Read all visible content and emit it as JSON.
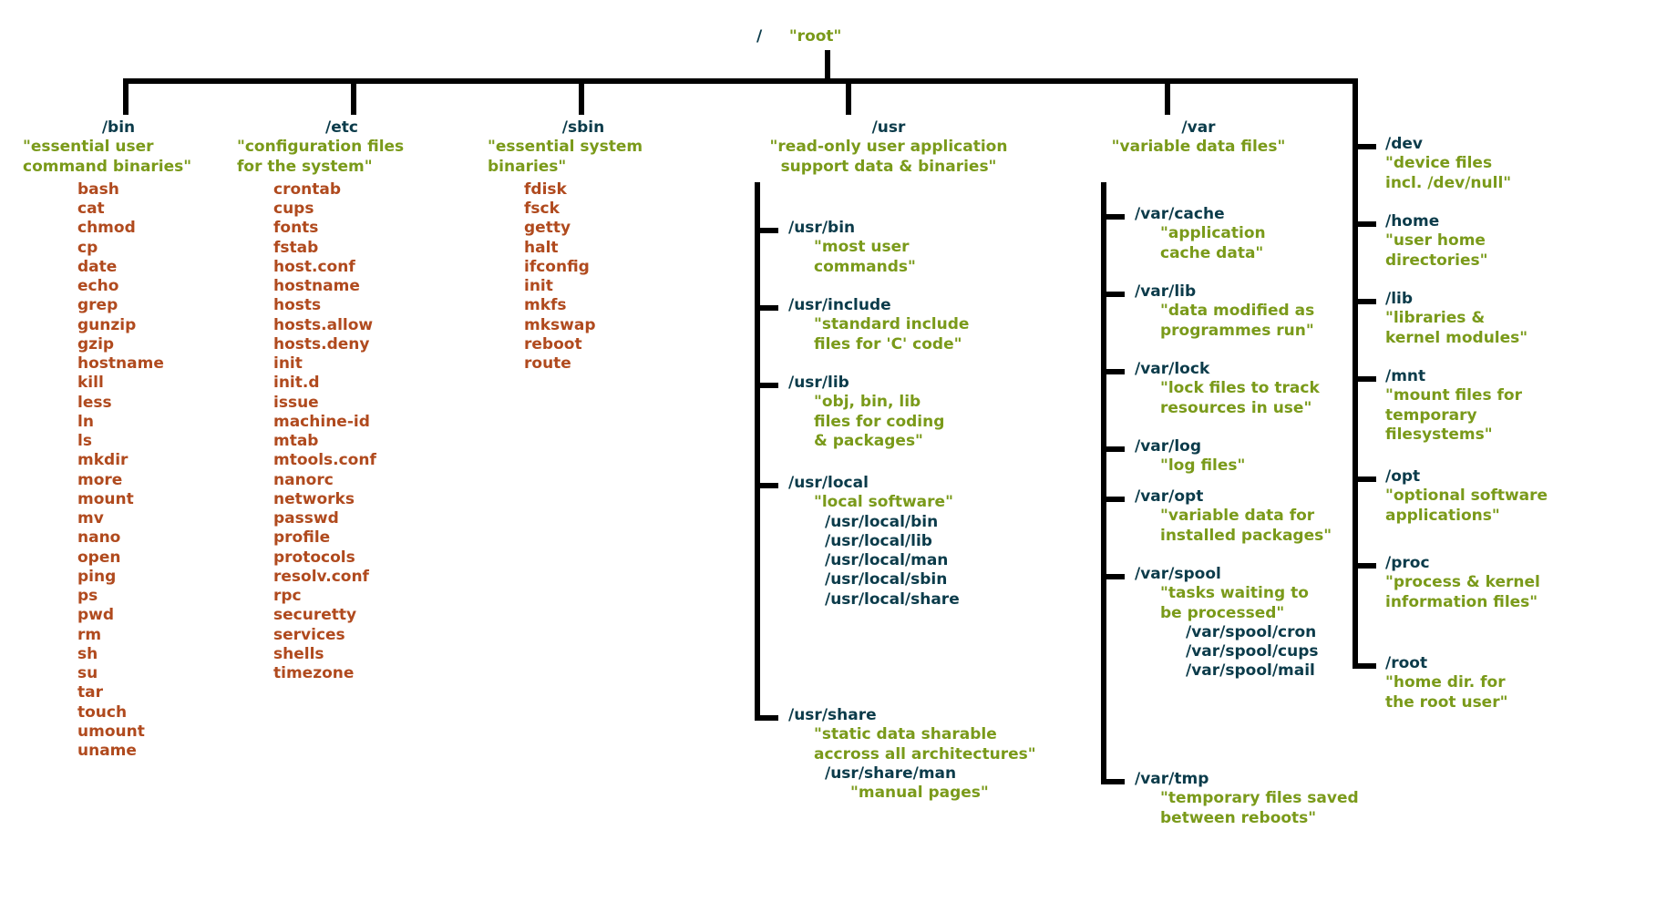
{
  "root": {
    "path": "/    \"root\"",
    "path_plain": "/",
    "desc": "\"root\""
  },
  "bin": {
    "path": "/bin",
    "desc": "\"essential user\ncommand binaries\"",
    "files": [
      "bash",
      "cat",
      "chmod",
      "cp",
      "date",
      "echo",
      "grep",
      "gunzip",
      "gzip",
      "hostname",
      "kill",
      "less",
      "ln",
      "ls",
      "mkdir",
      "more",
      "mount",
      "mv",
      "nano",
      "open",
      "ping",
      "ps",
      "pwd",
      "rm",
      "sh",
      "su",
      "tar",
      "touch",
      "umount",
      "uname"
    ]
  },
  "etc": {
    "path": "/etc",
    "desc": "\"configuration files\nfor the system\"",
    "files": [
      "crontab",
      "cups",
      "fonts",
      "fstab",
      "host.conf",
      "hostname",
      "hosts",
      "hosts.allow",
      "hosts.deny",
      "init",
      "init.d",
      "issue",
      "machine-id",
      "mtab",
      "mtools.conf",
      "nanorc",
      "networks",
      "passwd",
      "profile",
      "protocols",
      "resolv.conf",
      "rpc",
      "securetty",
      "services",
      "shells",
      "timezone"
    ]
  },
  "sbin": {
    "path": "/sbin",
    "desc": "\"essential system\nbinaries\"",
    "files": [
      "fdisk",
      "fsck",
      "getty",
      "halt",
      "ifconfig",
      "init",
      "mkfs",
      "mkswap",
      "reboot",
      "route"
    ]
  },
  "usr": {
    "path": "/usr",
    "desc": "\"read-only user application\nsupport data & binaries\"",
    "children": [
      {
        "path": "/usr/bin",
        "desc": "\"most user\ncommands\""
      },
      {
        "path": "/usr/include",
        "desc": "\"standard include\nfiles for 'C' code\""
      },
      {
        "path": "/usr/lib",
        "desc": "\"obj, bin, lib\nfiles for coding\n& packages\""
      },
      {
        "path": "/usr/local",
        "desc": "\"local software\"",
        "subpaths": [
          "/usr/local/bin",
          "/usr/local/lib",
          "/usr/local/man",
          "/usr/local/sbin",
          "/usr/local/share"
        ]
      },
      {
        "path": "/usr/share",
        "desc": "\"static data sharable\naccross all architectures\"",
        "sub": {
          "path": "/usr/share/man",
          "desc": "\"manual pages\""
        }
      }
    ]
  },
  "var": {
    "path": "/var",
    "desc": "\"variable data files\"",
    "children": [
      {
        "path": "/var/cache",
        "desc": "\"application\ncache data\""
      },
      {
        "path": "/var/lib",
        "desc": "\"data modified as\nprogrammes run\""
      },
      {
        "path": "/var/lock",
        "desc": "\"lock files to track\nresources in use\""
      },
      {
        "path": "/var/log",
        "desc": "\"log files\""
      },
      {
        "path": "/var/opt",
        "desc": "\"variable data for\ninstalled packages\""
      },
      {
        "path": "/var/spool",
        "desc": "\"tasks waiting to\nbe processed\"",
        "subpaths": [
          "/var/spool/cron",
          "/var/spool/cups",
          "/var/spool/mail"
        ]
      },
      {
        "path": "/var/tmp",
        "desc": "\"temporary files saved\nbetween reboots\""
      }
    ]
  },
  "right": [
    {
      "path": "/dev",
      "desc": "\"device files\nincl. /dev/null\""
    },
    {
      "path": "/home",
      "desc": "\"user home\ndirectories\""
    },
    {
      "path": "/lib",
      "desc": "\"libraries &\nkernel modules\""
    },
    {
      "path": "/mnt",
      "desc": "\"mount files for\ntemporary\nfilesystems\""
    },
    {
      "path": "/opt",
      "desc": "\"optional software\napplications\""
    },
    {
      "path": "/proc",
      "desc": "\"process & kernel\ninformation files\""
    },
    {
      "path": "/root",
      "desc": "\"home dir. for\nthe root user\""
    }
  ]
}
